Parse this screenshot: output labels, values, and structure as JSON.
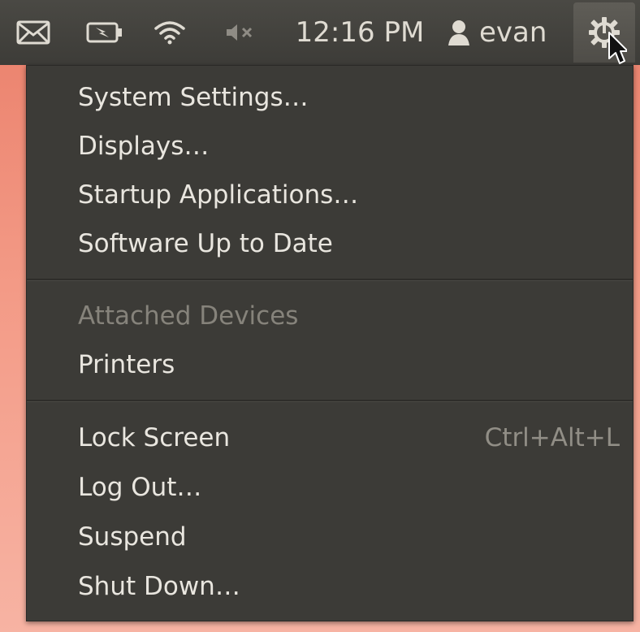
{
  "panel": {
    "clock": "12:16 PM",
    "user_name": "evan",
    "icons": {
      "mail": "envelope-icon",
      "battery": "battery-charging-icon",
      "network": "wifi-icon",
      "sound": "speaker-muted-icon",
      "user": "person-icon",
      "session": "power-gear-icon"
    }
  },
  "menu": {
    "group1": [
      {
        "label": "System Settings…"
      },
      {
        "label": "Displays…"
      },
      {
        "label": "Startup Applications…"
      },
      {
        "label": "Software Up to Date"
      }
    ],
    "group2": [
      {
        "label": "Attached Devices",
        "disabled": true
      },
      {
        "label": "Printers"
      }
    ],
    "group3": [
      {
        "label": "Lock Screen",
        "accel": "Ctrl+Alt+L"
      },
      {
        "label": "Log Out…"
      },
      {
        "label": "Suspend"
      },
      {
        "label": "Shut Down…"
      }
    ]
  },
  "colors": {
    "panel_bg": "#3d3c38",
    "menu_bg": "#3c3b37",
    "text": "#e9e6df",
    "disabled_text": "#86837b",
    "desktop": "#ea7f6a"
  }
}
